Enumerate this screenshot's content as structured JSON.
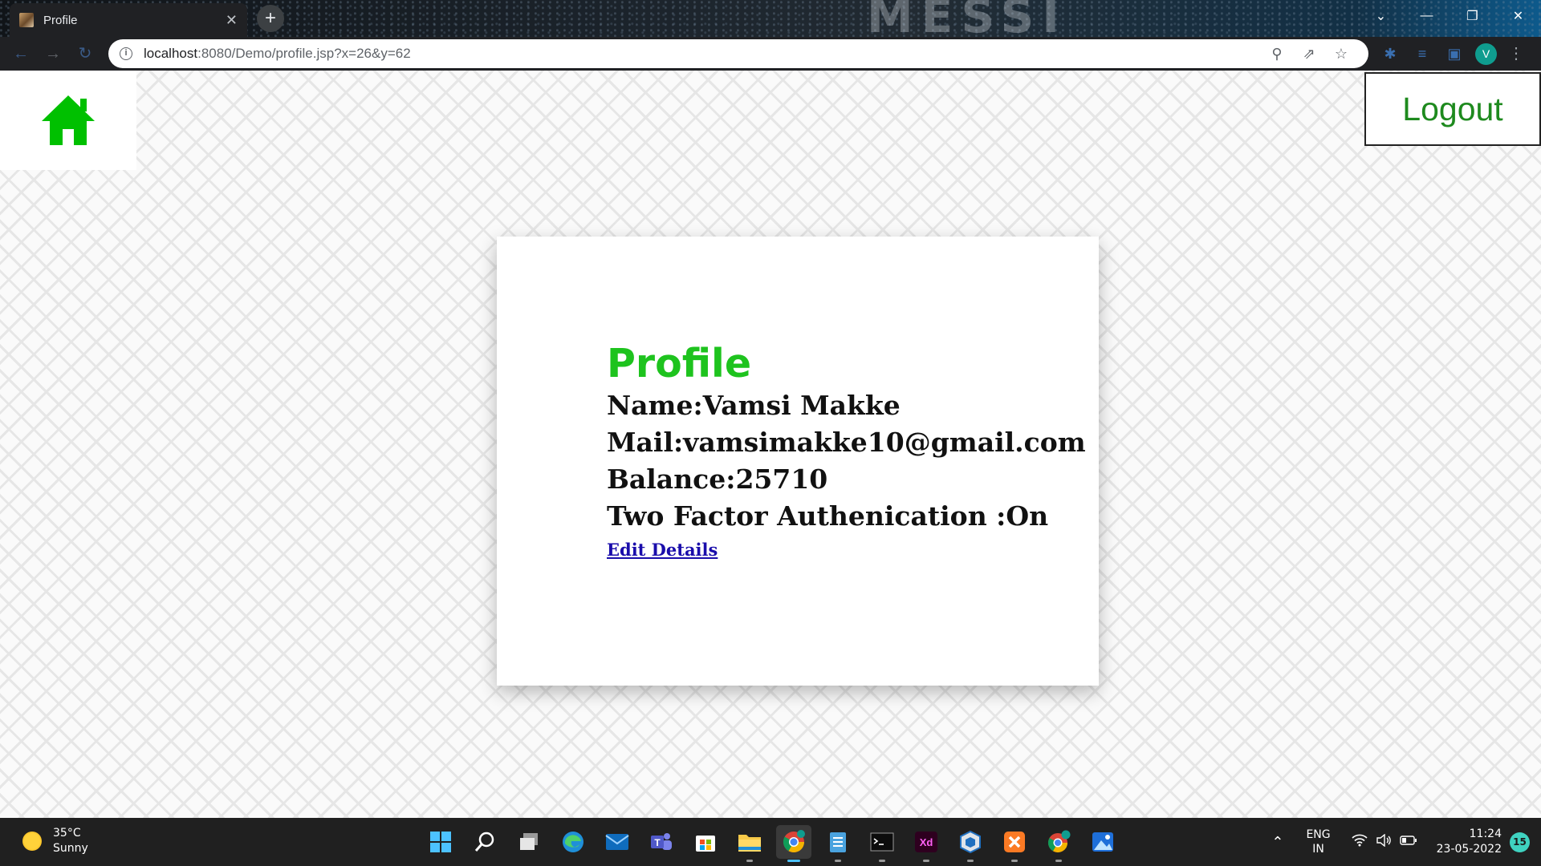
{
  "browser": {
    "tab_title": "Profile",
    "tab_close": "✕",
    "new_tab": "+",
    "decor_text": "MESSI",
    "url_host": "localhost",
    "url_rest": ":8080/Demo/profile.jsp?x=26&y=62",
    "profile_initial": "V",
    "icons": [
      "back-arrow-icon",
      "forward-arrow-icon",
      "reload-icon",
      "info-icon",
      "zoom-icon",
      "share-icon",
      "star-icon",
      "extensions-icon",
      "reading-list-icon",
      "side-panel-icon",
      "menu-icon"
    ]
  },
  "header": {
    "logout_label": "Logout",
    "home_icon_color": "#00c000",
    "logout_color": "#1e8a1e"
  },
  "profile": {
    "title": "Profile",
    "name_line": "Name:Vamsi Makke",
    "mail_line": "Mail:vamsimakke10@gmail.com",
    "balance_line": "Balance:25710",
    "twofa_line": "Two Factor Authenication :On",
    "edit_link": "Edit Details",
    "title_color": "#1ec31e"
  },
  "taskbar": {
    "weather_temp": "35°C",
    "weather_desc": "Sunny",
    "lang_top": "ENG",
    "lang_bottom": "IN",
    "time": "11:24",
    "date": "23-05-2022",
    "notification_count": "15",
    "xd_label": "Xd",
    "app_icons": [
      "windows-start-icon",
      "search-icon",
      "task-view-icon",
      "edge-icon",
      "mail-icon",
      "teams-icon",
      "store-icon",
      "file-explorer-icon",
      "chrome-icon",
      "notepad-icon",
      "terminal-icon",
      "adobe-xd-icon",
      "virtualbox-icon",
      "xampp-icon",
      "chrome-profile-icon",
      "photos-icon"
    ]
  }
}
